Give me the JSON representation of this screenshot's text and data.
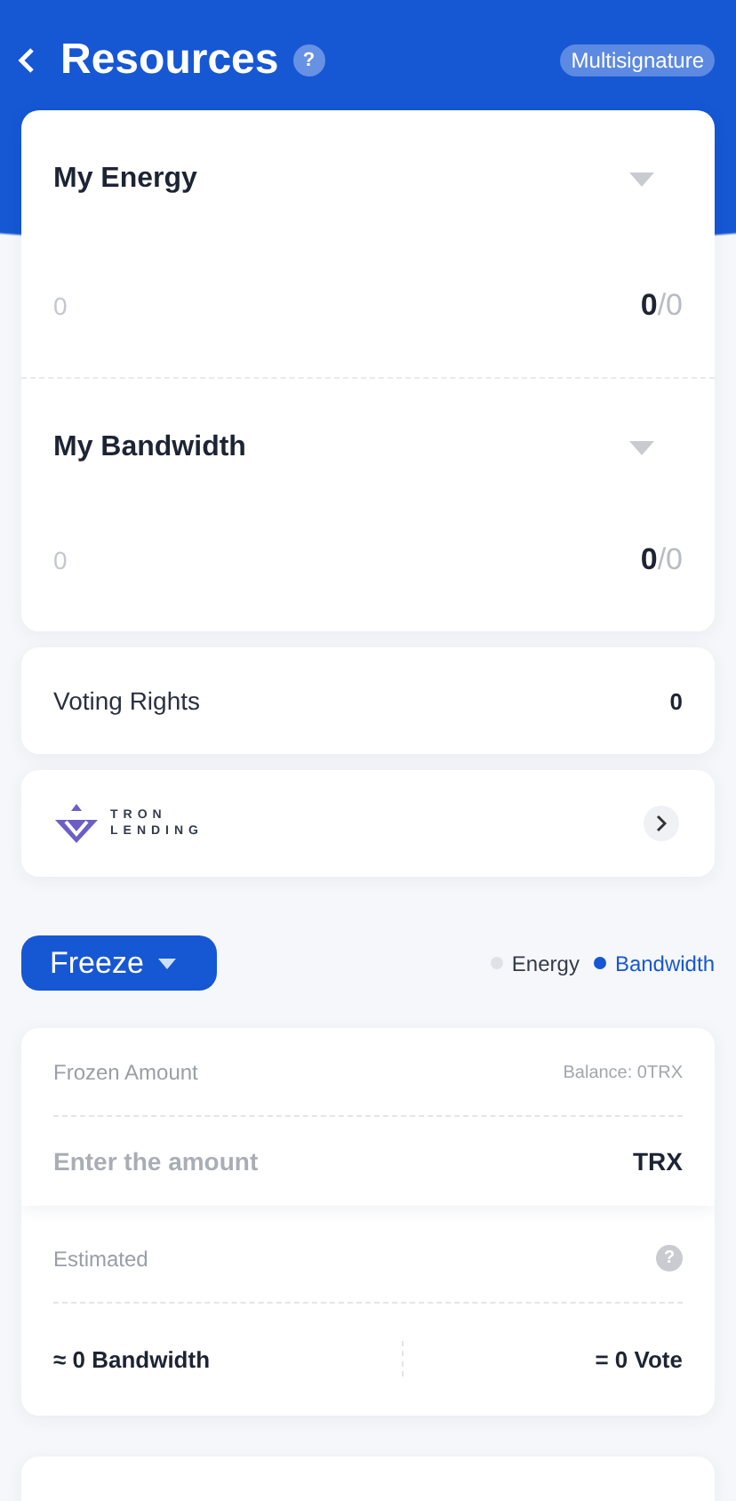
{
  "header": {
    "title": "Resources",
    "badge": "Multisignature",
    "help": "?"
  },
  "resources": [
    {
      "title": "My Energy",
      "current": "0",
      "reading": "**0**/0"
    },
    {
      "title": "My Bandwidth",
      "current": "0",
      "reading": "**0**/0"
    }
  ],
  "voting": {
    "label": "Voting Rights",
    "value": "0"
  },
  "lending": {
    "logo_lines": [
      "TRON",
      "LENDING"
    ]
  },
  "freeze": {
    "label": "Freeze",
    "options": [
      {
        "label": "Energy",
        "selected": false
      },
      {
        "label": "Bandwidth",
        "selected": true
      }
    ]
  },
  "form": {
    "frozen_label": "Frozen Amount",
    "balance": "Balance: 0TRX",
    "placeholder": "Enter the amount",
    "unit": "TRX",
    "estimated_label": "Estimated",
    "estimated_help": "?",
    "estimate": "≈ 0 Bandwidth",
    "votes": "= 0 Vote"
  }
}
